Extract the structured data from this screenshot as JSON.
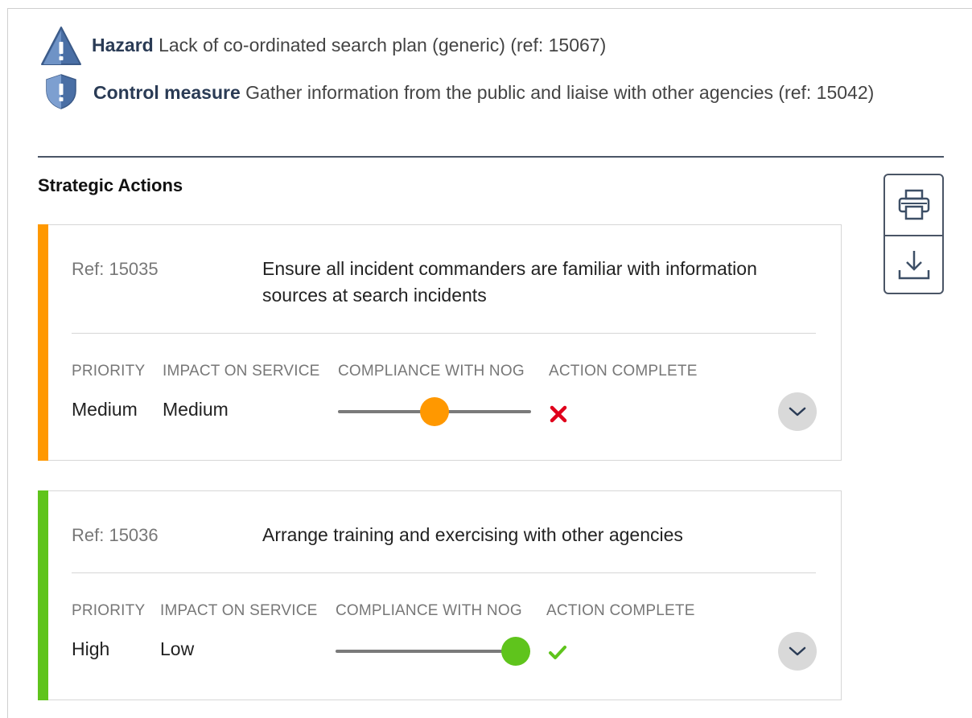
{
  "hazard": {
    "label": "Hazard",
    "text": "Lack of co-ordinated search plan (generic) (ref: 15067)",
    "icon": "warning-triangle-icon"
  },
  "control_measure": {
    "label": "Control measure",
    "text": "Gather information from the public and liaise with other agencies (ref: 15042)",
    "icon": "shield-icon"
  },
  "section_title": "Strategic Actions",
  "toolbar": {
    "print_icon": "print-icon",
    "download_icon": "download-icon"
  },
  "columns": {
    "priority": "PRIORITY",
    "impact": "IMPACT ON SERVICE",
    "compliance": "COMPLIANCE WITH NOG",
    "complete": "ACTION COMPLETE"
  },
  "actions": [
    {
      "ref": "Ref: 15035",
      "description": "Ensure all incident commanders are familiar with information sources at search incidents",
      "priority": "Medium",
      "impact": "Medium",
      "compliance_level": 0.5,
      "complete": false,
      "status_icon": "cross-icon",
      "accent_color": "#ff9800"
    },
    {
      "ref": "Ref: 15036",
      "description": "Arrange training and exercising with other agencies",
      "priority": "High",
      "impact": "Low",
      "compliance_level": 1.0,
      "complete": true,
      "status_icon": "check-icon",
      "accent_color": "#5fc41c"
    }
  ],
  "colors": {
    "heading": "#2a3b55",
    "cross": "#e0001b",
    "check": "#5fc41c",
    "track": "#7a7a7a"
  }
}
